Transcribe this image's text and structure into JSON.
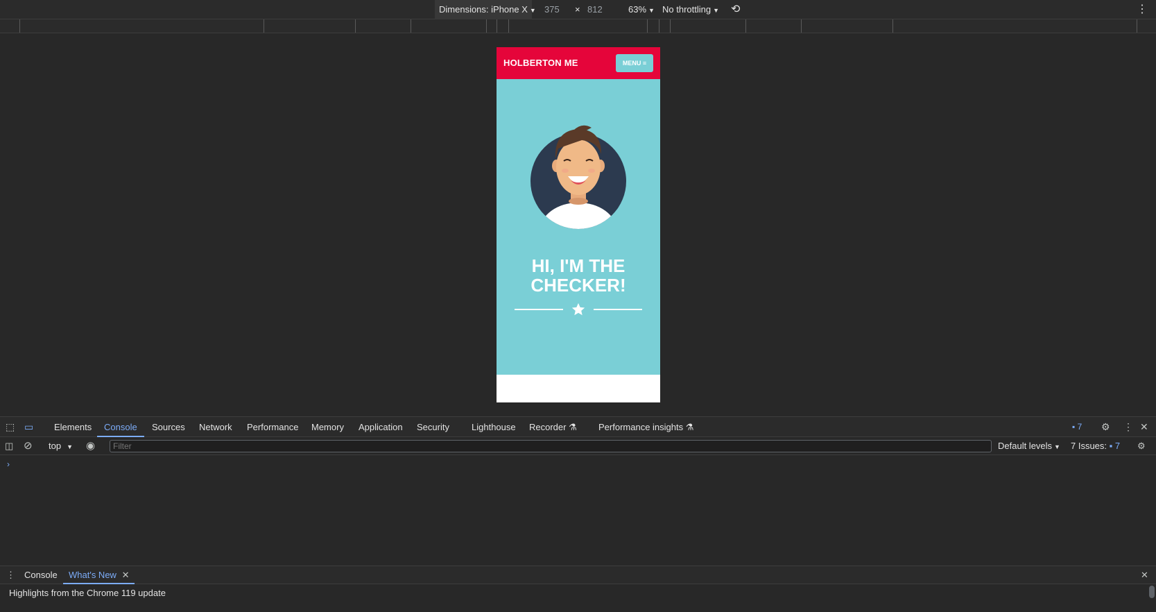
{
  "device_toolbar": {
    "dimensions_label": "Dimensions: iPhone X",
    "width": "375",
    "times": "×",
    "height": "812",
    "zoom": "63%",
    "throttling": "No throttling",
    "rotate_icon": "rotate-icon",
    "more_icon": "more-vert-icon"
  },
  "phone_page": {
    "logo": "HOLBERTON ME",
    "menu_label": "MENU ≡",
    "hero_title_line1": "HI, I'M THE",
    "hero_title_line2": "CHECKER!",
    "star_icon": "star-icon",
    "colors": {
      "header": "#e5053a",
      "hero": "#7acfd6",
      "avatar_bg": "#2c3a4f"
    }
  },
  "devtools": {
    "tabs": [
      "Elements",
      "Console",
      "Sources",
      "Network",
      "Performance",
      "Memory",
      "Application",
      "Security",
      "Lighthouse",
      "Recorder",
      "Performance insights"
    ],
    "active_tab": "Console",
    "issues_count": "7",
    "console": {
      "context": "top",
      "filter_placeholder": "Filter",
      "levels": "Default levels",
      "issues_label": "7 Issues:",
      "issues_badge": "7",
      "prompt": "›"
    },
    "drawer": {
      "tabs": [
        "Console",
        "What's New"
      ],
      "active_tab": "What's New",
      "highlights": "Highlights from the Chrome 119 update"
    }
  }
}
